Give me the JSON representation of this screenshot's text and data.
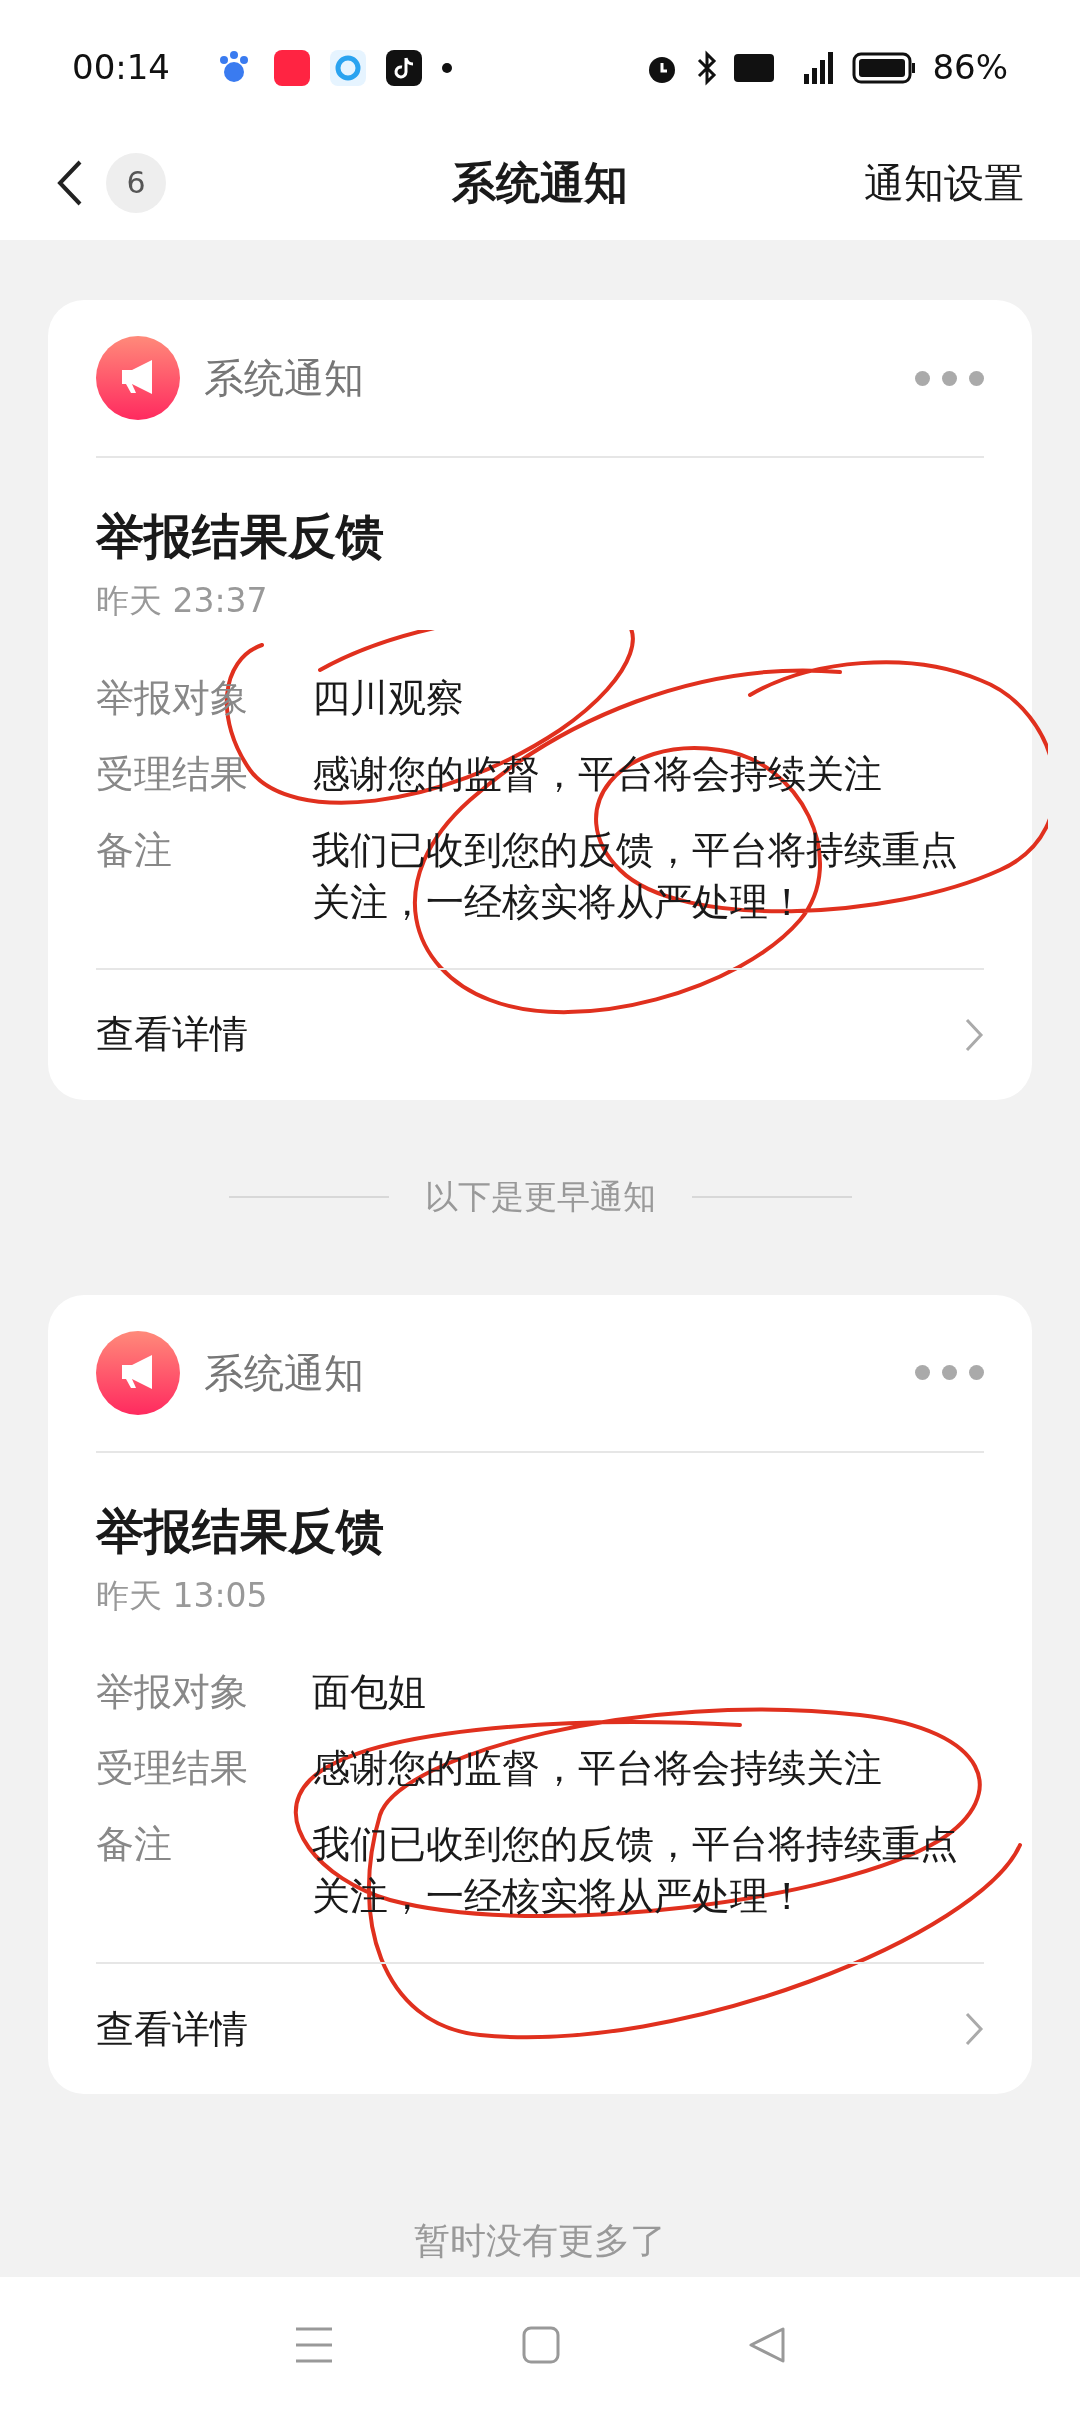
{
  "status_bar": {
    "time": "00:14",
    "battery": "86%"
  },
  "header": {
    "back_count": "6",
    "title": "系统通知",
    "action": "通知设置"
  },
  "notices": [
    {
      "source": "系统通知",
      "title": "举报结果反馈",
      "time": "昨天 23:37",
      "fields": [
        {
          "label": "举报对象",
          "value": "四川观察"
        },
        {
          "label": "受理结果",
          "value": "感谢您的监督，平台将会持续关注"
        },
        {
          "label": "备注",
          "value": "我们已收到您的反馈，平台将持续重点关注，一经核实将从严处理！"
        }
      ],
      "link": "查看详情"
    },
    {
      "source": "系统通知",
      "title": "举报结果反馈",
      "time": "昨天 13:05",
      "fields": [
        {
          "label": "举报对象",
          "value": "面包姐"
        },
        {
          "label": "受理结果",
          "value": "感谢您的监督，平台将会持续关注"
        },
        {
          "label": "备注",
          "value": "我们已收到您的反馈，平台将持续重点关注，一经核实将从严处理！"
        }
      ],
      "link": "查看详情"
    }
  ],
  "divider_text": "以下是更早通知",
  "footer": "暂时没有更多了"
}
